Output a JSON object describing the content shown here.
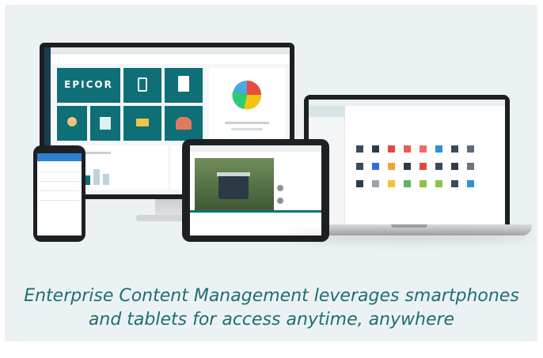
{
  "brand": {
    "logo_text": "EPICOR",
    "accent": "#1e6e72",
    "tile_color": "#0f6f76"
  },
  "caption": {
    "line1": "Enterprise Content Management leverages smartphones",
    "line2": "and tablets for access anytime, anywhere"
  },
  "devices": [
    "monitor",
    "laptop",
    "tablet",
    "smartphone"
  ]
}
